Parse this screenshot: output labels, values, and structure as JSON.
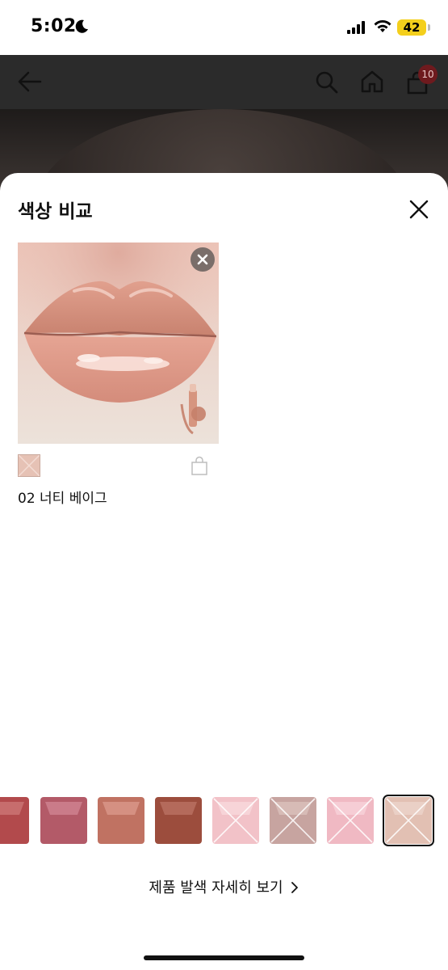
{
  "status_bar": {
    "time": "5:02",
    "battery": "42"
  },
  "app_bar": {
    "cart_count": "10",
    "icons": [
      "back-arrow-icon",
      "search-icon",
      "home-icon",
      "cart-icon"
    ]
  },
  "sheet": {
    "title": "색상 비교",
    "compare_item": {
      "shade_name": "02 너티 베이그",
      "swatch_color": "#e5c2b5"
    },
    "swatches": [
      {
        "color": "#b24a4c",
        "sheen": "#d98a88",
        "crossed": false,
        "selected": false
      },
      {
        "color": "#b35a68",
        "sheen": "#dd97a4",
        "crossed": false,
        "selected": false
      },
      {
        "color": "#c07262",
        "sheen": "#e5a99c",
        "crossed": false,
        "selected": false
      },
      {
        "color": "#9c4d3d",
        "sheen": "#c98474",
        "crossed": false,
        "selected": false
      },
      {
        "color": "#f2c2c8",
        "sheen": "#fbe3e6",
        "crossed": true,
        "selected": false
      },
      {
        "color": "#c7a4a0",
        "sheen": "#e4cdc9",
        "crossed": true,
        "selected": false
      },
      {
        "color": "#f0b9c3",
        "sheen": "#fbdfe4",
        "crossed": true,
        "selected": false
      },
      {
        "color": "#e2c0b3",
        "sheen": "#f1ddd5",
        "crossed": true,
        "selected": true
      }
    ],
    "detail_link": "제품 발색 자세히 보기"
  }
}
